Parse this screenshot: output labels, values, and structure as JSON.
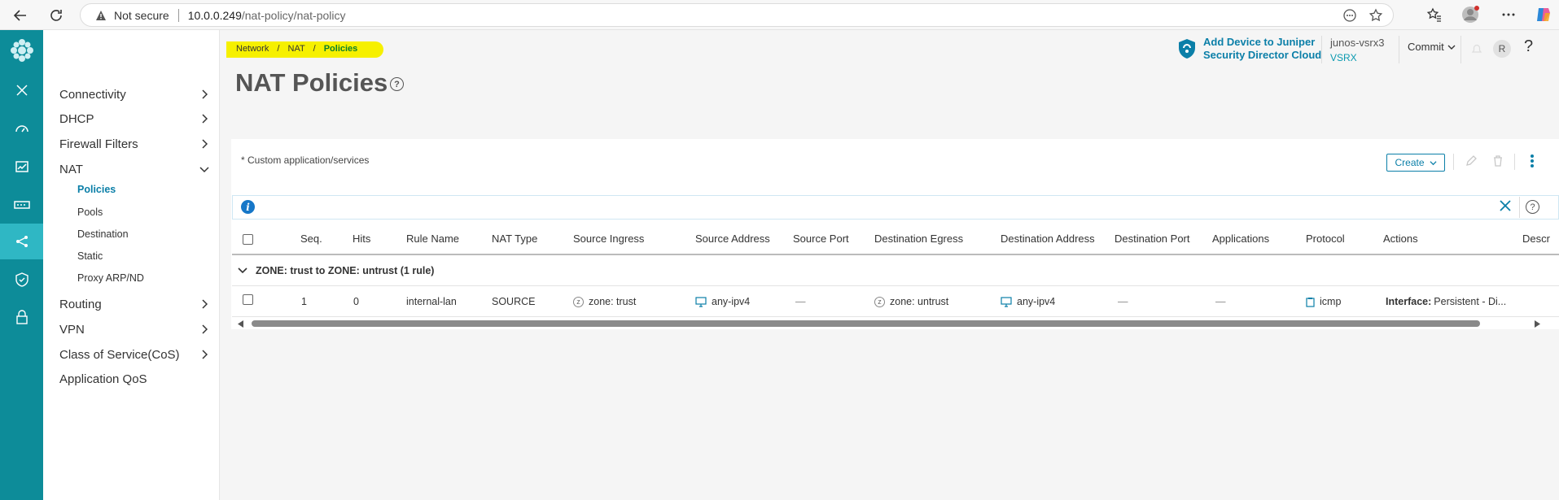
{
  "browser": {
    "not_secure": "Not secure",
    "url_host": "10.0.0.249",
    "url_path": "/nat-policy/nat-policy"
  },
  "colors": {
    "rail": "#0d8c99",
    "rail_active": "#2fb7c4",
    "accent": "#0b7fa8",
    "breadcrumb_highlight": "#f6f000"
  },
  "rail": {
    "icons": [
      "logo-icon",
      "close-icon",
      "dashboard-icon",
      "monitor-icon",
      "devices-icon",
      "network-icon",
      "security-policy-icon",
      "lock-icon"
    ],
    "active": "network-icon"
  },
  "menu": {
    "connectivity": "Connectivity",
    "dhcp": "DHCP",
    "firewall_filters": "Firewall Filters",
    "nat": "NAT",
    "nat_sub": {
      "policies": "Policies",
      "pools": "Pools",
      "destination": "Destination",
      "static": "Static",
      "proxy_arp": "Proxy ARP/ND"
    },
    "routing": "Routing",
    "vpn": "VPN",
    "cos": "Class of Service(CoS)",
    "app_qos": "Application QoS"
  },
  "breadcrumb": {
    "network": "Network",
    "nat": "NAT",
    "policies": "Policies",
    "sep": "/"
  },
  "page": {
    "title": "NAT Policies",
    "help": "?"
  },
  "topbar": {
    "sd_line1": "Add Device to Juniper",
    "sd_line2": "Security Director Cloud",
    "device_name": "junos-vsrx3",
    "device_type": "VSRX",
    "commit": "Commit",
    "avatar": "R",
    "help": "?"
  },
  "card": {
    "custom_note": "* Custom application/services",
    "create": "Create"
  },
  "table": {
    "headers": {
      "seq": "Seq.",
      "hits": "Hits",
      "rule_name": "Rule Name",
      "nat_type": "NAT Type",
      "source_ingress": "Source Ingress",
      "source_address": "Source Address",
      "source_port": "Source Port",
      "destination_egress": "Destination Egress",
      "destination_address": "Destination Address",
      "destination_port": "Destination Port",
      "applications": "Applications",
      "protocol": "Protocol",
      "actions": "Actions",
      "description": "Descr"
    },
    "group": "ZONE: trust to ZONE: untrust (1 rule)",
    "row": {
      "seq": "1",
      "hits": "0",
      "rule_name": "internal-lan",
      "nat_type": "SOURCE",
      "source_ingress": "zone: trust",
      "source_address": "any-ipv4",
      "source_port": "—",
      "destination_egress": "zone: untrust",
      "destination_address": "any-ipv4",
      "destination_port": "—",
      "applications": "—",
      "protocol": "icmp",
      "actions_label": "Interface:",
      "actions_value": "Persistent - Di..."
    },
    "zone_badge": "z"
  }
}
